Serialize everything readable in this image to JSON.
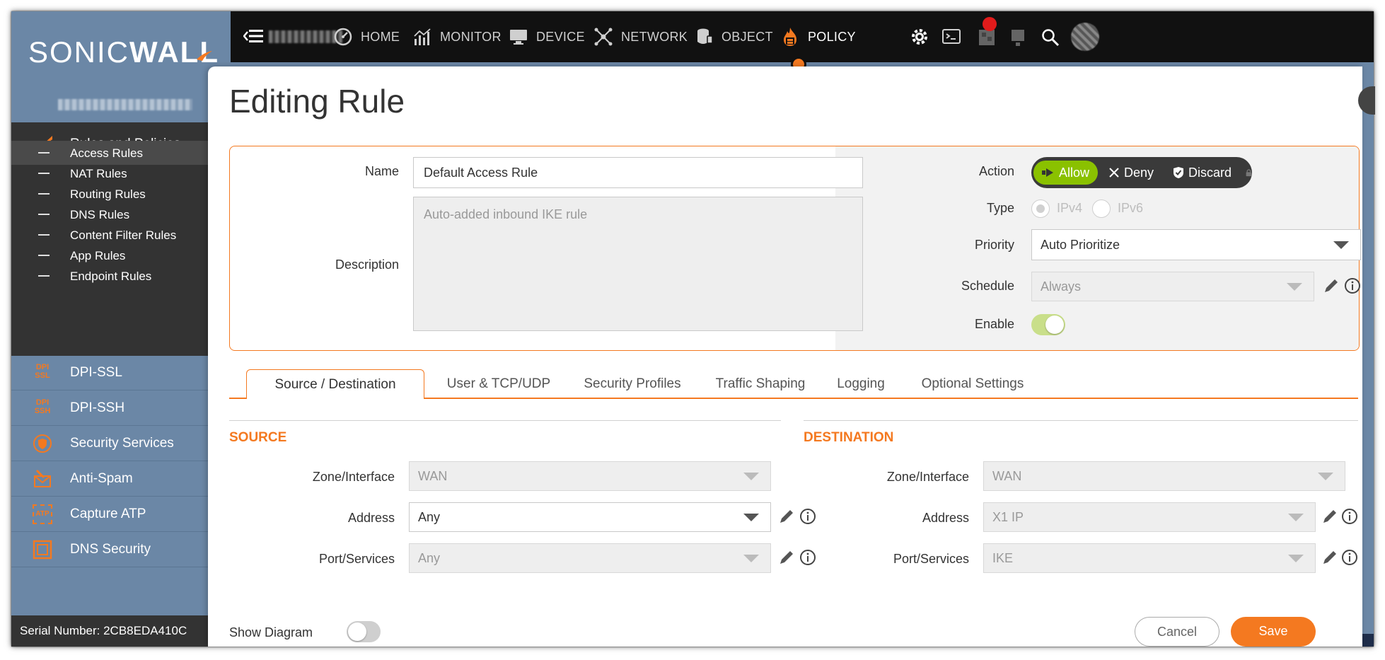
{
  "brand": {
    "logo_text_a": "SONIC",
    "logo_text_b": "WALL"
  },
  "sidebar": {
    "section_title": "Rules and Policies",
    "sub_items": [
      {
        "label": "Access Rules"
      },
      {
        "label": "NAT Rules"
      },
      {
        "label": "Routing Rules"
      },
      {
        "label": "DNS Rules"
      },
      {
        "label": "Content Filter Rules"
      },
      {
        "label": "App Rules"
      },
      {
        "label": "Endpoint Rules"
      }
    ],
    "sections": [
      {
        "label": "DPI-SSL",
        "icon": "dpi-ssl-icon",
        "icon_text_1": "DPI",
        "icon_text_2": "SSL"
      },
      {
        "label": "DPI-SSH",
        "icon": "dpi-ssh-icon",
        "icon_text_1": "DPI",
        "icon_text_2": "SSH"
      },
      {
        "label": "Security Services",
        "icon": "shield-icon"
      },
      {
        "label": "Anti-Spam",
        "icon": "envelope-icon"
      },
      {
        "label": "Capture ATP",
        "icon": "atp-icon",
        "icon_text_1": "ATP"
      },
      {
        "label": "DNS Security",
        "icon": "square-icon"
      }
    ],
    "serial": "Serial Number: 2CB8EDA410C"
  },
  "topbar": {
    "nav": [
      {
        "label": "HOME",
        "icon": "gauge-icon"
      },
      {
        "label": "MONITOR",
        "icon": "bar-chart-icon"
      },
      {
        "label": "DEVICE",
        "icon": "monitor-icon"
      },
      {
        "label": "NETWORK",
        "icon": "network-icon"
      },
      {
        "label": "OBJECT",
        "icon": "cylinder-icon"
      },
      {
        "label": "POLICY",
        "icon": "flame-icon"
      }
    ],
    "colors": {
      "accent": "#f47920",
      "bar_bg": "#111111"
    }
  },
  "modal": {
    "title": "Editing Rule",
    "name_label": "Name",
    "name_value": "Default Access Rule",
    "description_label": "Description",
    "description_value": "Auto-added inbound IKE rule",
    "action_label": "Action",
    "actions": {
      "allow": "Allow",
      "deny": "Deny",
      "discard": "Discard"
    },
    "type_label": "Type",
    "type_ipv4": "IPv4",
    "type_ipv6": "IPv6",
    "priority_label": "Priority",
    "priority_value": "Auto Prioritize",
    "schedule_label": "Schedule",
    "schedule_value": "Always",
    "enable_label": "Enable",
    "tabs": [
      {
        "label": "Source / Destination"
      },
      {
        "label": "User & TCP/UDP"
      },
      {
        "label": "Security Profiles"
      },
      {
        "label": "Traffic Shaping"
      },
      {
        "label": "Logging"
      },
      {
        "label": "Optional Settings"
      }
    ],
    "source": {
      "title": "SOURCE",
      "zone_label": "Zone/Interface",
      "zone_value": "WAN",
      "address_label": "Address",
      "address_value": "Any",
      "port_label": "Port/Services",
      "port_value": "Any"
    },
    "destination": {
      "title": "DESTINATION",
      "zone_label": "Zone/Interface",
      "zone_value": "WAN",
      "address_label": "Address",
      "address_value": "X1 IP",
      "port_label": "Port/Services",
      "port_value": "IKE"
    },
    "show_diagram_label": "Show Diagram",
    "cancel_label": "Cancel",
    "save_label": "Save"
  }
}
